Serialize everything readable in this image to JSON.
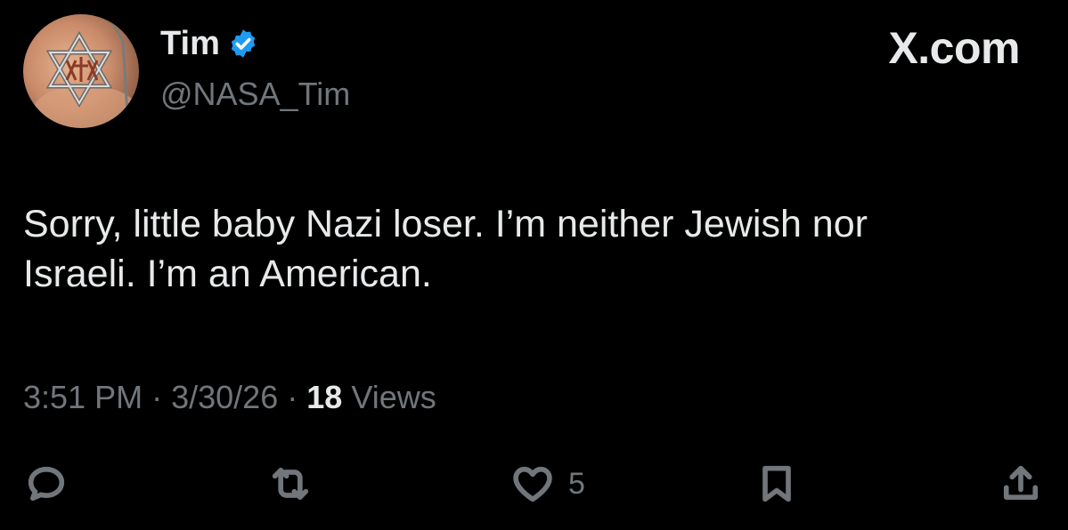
{
  "author": {
    "display_name": "Tim",
    "handle": "@NASA_Tim",
    "verified_color": "#1d9bf0"
  },
  "brand": "X.com",
  "tweet": {
    "text": "Sorry, little baby Nazi loser. I’m neither Jewish nor\nIsraeli. I’m an American.",
    "time": "3:51 PM",
    "date": "3/30/26",
    "separator": "·",
    "views_count": "18",
    "views_label": "Views"
  },
  "actions": {
    "reply_icon": "reply-icon",
    "retweet_icon": "retweet-icon",
    "like_icon": "heart-icon",
    "like_count": "5",
    "bookmark_icon": "bookmark-icon",
    "share_icon": "share-icon"
  },
  "colors": {
    "background": "#000000",
    "primary_text": "#e7e9ea",
    "secondary_text": "#71767b",
    "verified": "#1d9bf0"
  }
}
